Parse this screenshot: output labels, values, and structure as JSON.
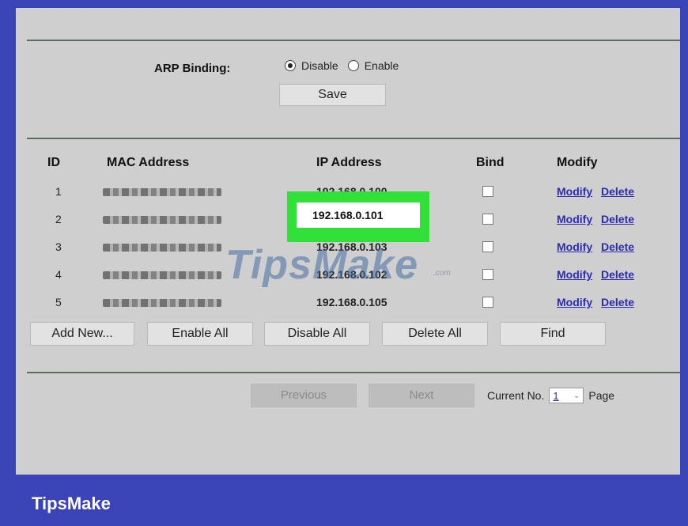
{
  "arp": {
    "label": "ARP Binding:",
    "options": [
      "Disable",
      "Enable"
    ],
    "selected": "Disable",
    "save_label": "Save"
  },
  "table": {
    "headers": [
      "ID",
      "MAC Address",
      "IP Address",
      "Bind",
      "Modify"
    ],
    "rows": [
      {
        "id": "1",
        "ip": "192.168.0.100",
        "bind": false
      },
      {
        "id": "2",
        "ip": "192.168.0.101",
        "bind": false
      },
      {
        "id": "3",
        "ip": "192.168.0.103",
        "bind": false
      },
      {
        "id": "4",
        "ip": "192.168.0.102",
        "bind": false
      },
      {
        "id": "5",
        "ip": "192.168.0.105",
        "bind": false
      }
    ],
    "modify_link": "Modify",
    "delete_link": "Delete"
  },
  "actions": {
    "add_new": "Add New...",
    "enable_all": "Enable All",
    "disable_all": "Disable All",
    "delete_all": "Delete All",
    "find": "Find"
  },
  "pager": {
    "previous": "Previous",
    "next": "Next",
    "current_label": "Current No.",
    "current_value": "1",
    "page_label": "Page"
  },
  "watermark": {
    "main": "TipsMake",
    "small": ".com"
  },
  "brand": "TipsMake",
  "colors": {
    "frame": "#3b44b6",
    "panel": "#cfcfcf",
    "highlight": "#32e03a",
    "link": "#2b2bb5"
  }
}
